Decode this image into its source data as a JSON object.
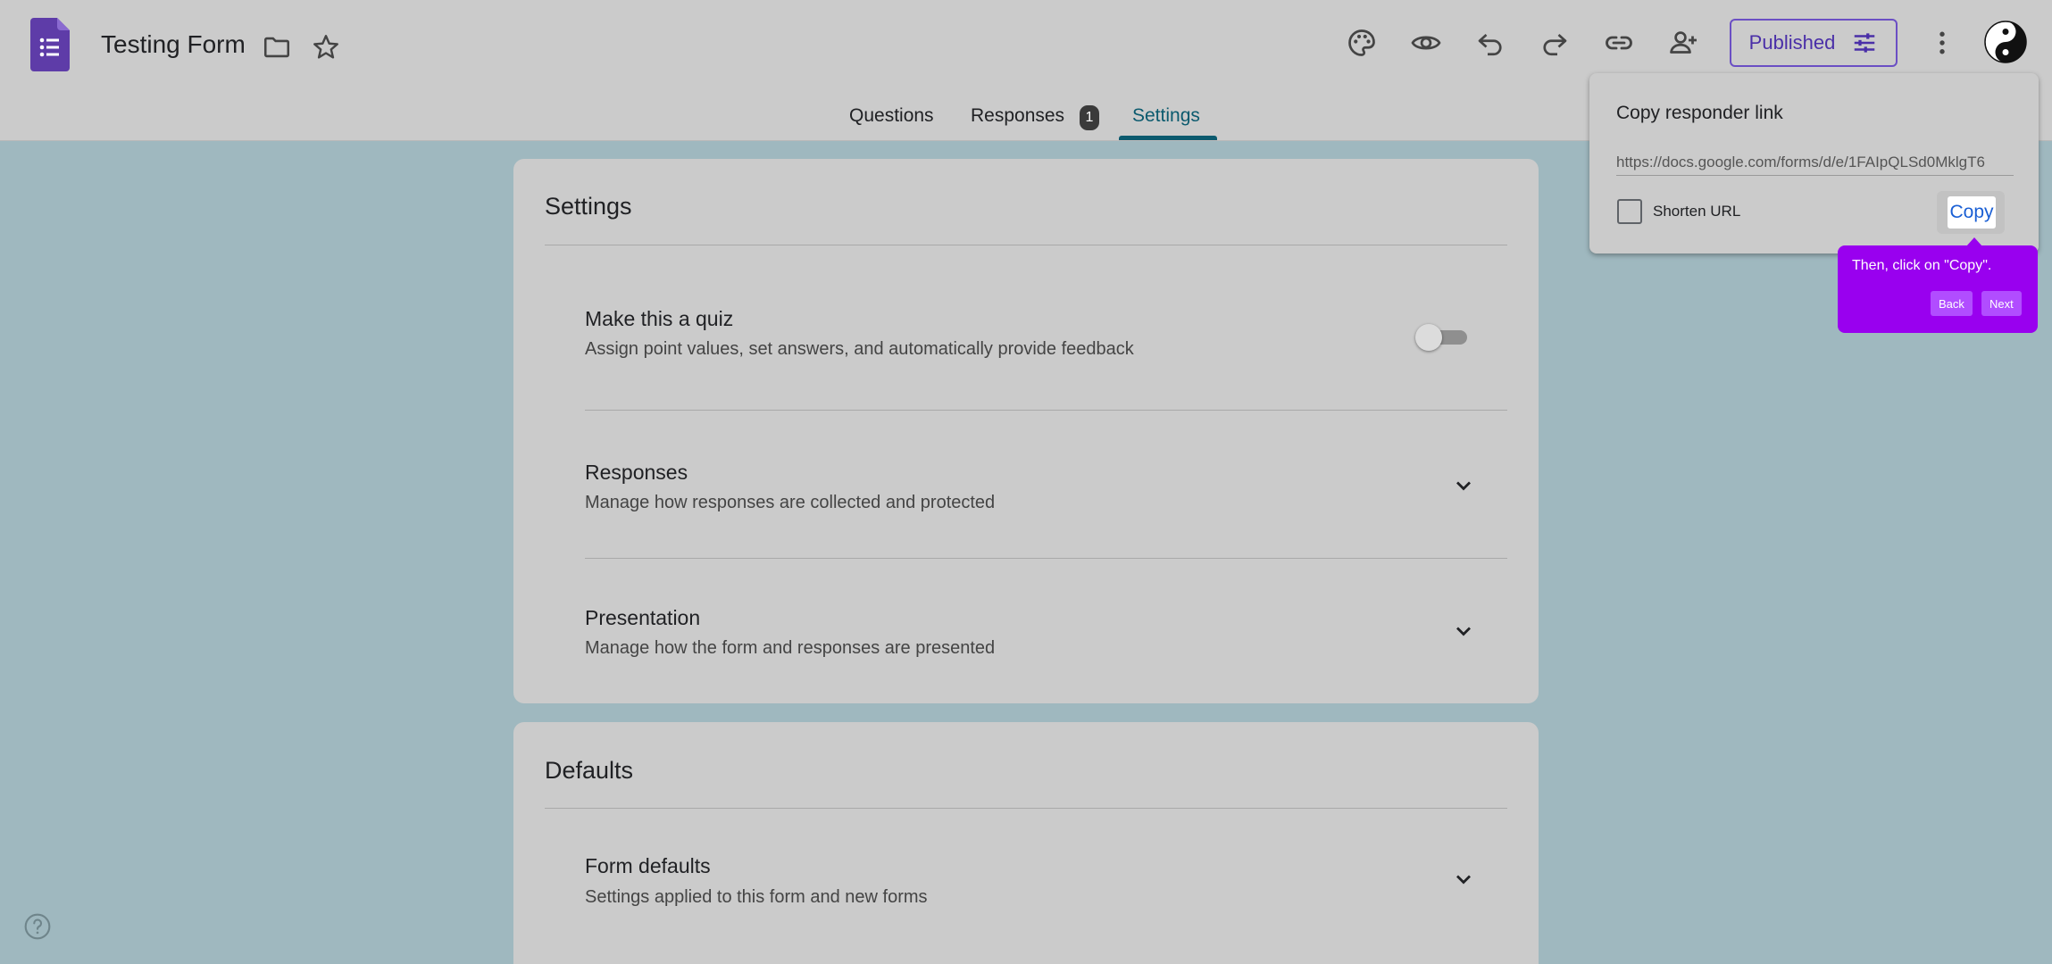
{
  "header": {
    "title": "Testing Form",
    "publish_label": "Published",
    "icons": [
      "forms-logo-icon",
      "folder-icon",
      "star-icon",
      "palette-icon",
      "eye-icon",
      "undo-icon",
      "redo-icon",
      "link-icon",
      "add-person-icon",
      "tune-icon",
      "more-vert-icon",
      "avatar"
    ]
  },
  "tabs": {
    "questions": "Questions",
    "responses": "Responses",
    "responses_badge": "1",
    "settings": "Settings",
    "active": "settings"
  },
  "settings_card": {
    "title": "Settings",
    "rows": [
      {
        "title": "Make this a quiz",
        "subtitle": "Assign point values, set answers, and automatically provide feedback",
        "toggle_on": false
      },
      {
        "title": "Responses",
        "subtitle": "Manage how responses are collected and protected"
      },
      {
        "title": "Presentation",
        "subtitle": "Manage how the form and responses are presented"
      }
    ]
  },
  "defaults_card": {
    "title": "Defaults",
    "rows": [
      {
        "title": "Form defaults",
        "subtitle": "Settings applied to this form and new forms"
      }
    ]
  },
  "popup": {
    "title": "Copy responder link",
    "url": "https://docs.google.com/forms/d/e/1FAIpQLSd0MklgT6",
    "shorten_label": "Shorten URL",
    "shorten_checked": false,
    "copy_label": "Copy"
  },
  "tour": {
    "text": "Then, click on \"Copy\".",
    "back_label": "Back",
    "next_label": "Next"
  },
  "colors": {
    "background": "#9fb8bf",
    "surface": "#cbcbcb",
    "accent": "#6b4fc4",
    "tab_active": "#0b5a6e",
    "tour": "#9900ef",
    "copy_link": "#1a5fd4"
  }
}
